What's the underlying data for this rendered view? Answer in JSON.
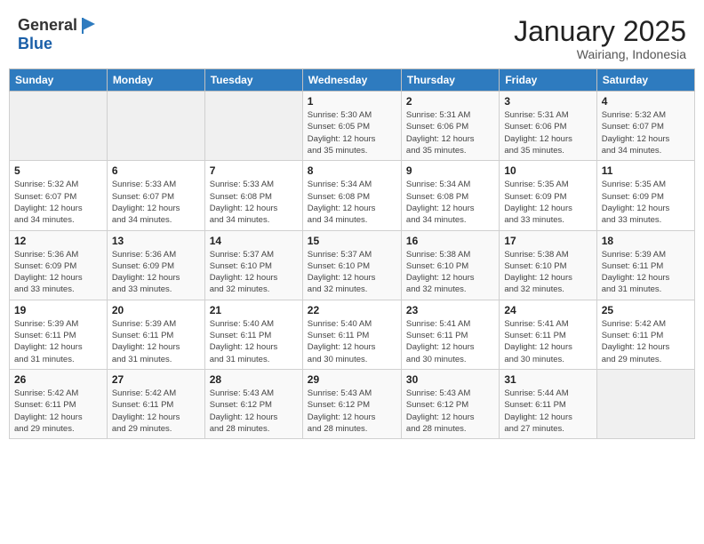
{
  "logo": {
    "general": "General",
    "blue": "Blue"
  },
  "header": {
    "title": "January 2025",
    "subtitle": "Wairiang, Indonesia"
  },
  "weekdays": [
    "Sunday",
    "Monday",
    "Tuesday",
    "Wednesday",
    "Thursday",
    "Friday",
    "Saturday"
  ],
  "weeks": [
    [
      {
        "day": "",
        "info": ""
      },
      {
        "day": "",
        "info": ""
      },
      {
        "day": "",
        "info": ""
      },
      {
        "day": "1",
        "info": "Sunrise: 5:30 AM\nSunset: 6:05 PM\nDaylight: 12 hours\nand 35 minutes."
      },
      {
        "day": "2",
        "info": "Sunrise: 5:31 AM\nSunset: 6:06 PM\nDaylight: 12 hours\nand 35 minutes."
      },
      {
        "day": "3",
        "info": "Sunrise: 5:31 AM\nSunset: 6:06 PM\nDaylight: 12 hours\nand 35 minutes."
      },
      {
        "day": "4",
        "info": "Sunrise: 5:32 AM\nSunset: 6:07 PM\nDaylight: 12 hours\nand 34 minutes."
      }
    ],
    [
      {
        "day": "5",
        "info": "Sunrise: 5:32 AM\nSunset: 6:07 PM\nDaylight: 12 hours\nand 34 minutes."
      },
      {
        "day": "6",
        "info": "Sunrise: 5:33 AM\nSunset: 6:07 PM\nDaylight: 12 hours\nand 34 minutes."
      },
      {
        "day": "7",
        "info": "Sunrise: 5:33 AM\nSunset: 6:08 PM\nDaylight: 12 hours\nand 34 minutes."
      },
      {
        "day": "8",
        "info": "Sunrise: 5:34 AM\nSunset: 6:08 PM\nDaylight: 12 hours\nand 34 minutes."
      },
      {
        "day": "9",
        "info": "Sunrise: 5:34 AM\nSunset: 6:08 PM\nDaylight: 12 hours\nand 34 minutes."
      },
      {
        "day": "10",
        "info": "Sunrise: 5:35 AM\nSunset: 6:09 PM\nDaylight: 12 hours\nand 33 minutes."
      },
      {
        "day": "11",
        "info": "Sunrise: 5:35 AM\nSunset: 6:09 PM\nDaylight: 12 hours\nand 33 minutes."
      }
    ],
    [
      {
        "day": "12",
        "info": "Sunrise: 5:36 AM\nSunset: 6:09 PM\nDaylight: 12 hours\nand 33 minutes."
      },
      {
        "day": "13",
        "info": "Sunrise: 5:36 AM\nSunset: 6:09 PM\nDaylight: 12 hours\nand 33 minutes."
      },
      {
        "day": "14",
        "info": "Sunrise: 5:37 AM\nSunset: 6:10 PM\nDaylight: 12 hours\nand 32 minutes."
      },
      {
        "day": "15",
        "info": "Sunrise: 5:37 AM\nSunset: 6:10 PM\nDaylight: 12 hours\nand 32 minutes."
      },
      {
        "day": "16",
        "info": "Sunrise: 5:38 AM\nSunset: 6:10 PM\nDaylight: 12 hours\nand 32 minutes."
      },
      {
        "day": "17",
        "info": "Sunrise: 5:38 AM\nSunset: 6:10 PM\nDaylight: 12 hours\nand 32 minutes."
      },
      {
        "day": "18",
        "info": "Sunrise: 5:39 AM\nSunset: 6:11 PM\nDaylight: 12 hours\nand 31 minutes."
      }
    ],
    [
      {
        "day": "19",
        "info": "Sunrise: 5:39 AM\nSunset: 6:11 PM\nDaylight: 12 hours\nand 31 minutes."
      },
      {
        "day": "20",
        "info": "Sunrise: 5:39 AM\nSunset: 6:11 PM\nDaylight: 12 hours\nand 31 minutes."
      },
      {
        "day": "21",
        "info": "Sunrise: 5:40 AM\nSunset: 6:11 PM\nDaylight: 12 hours\nand 31 minutes."
      },
      {
        "day": "22",
        "info": "Sunrise: 5:40 AM\nSunset: 6:11 PM\nDaylight: 12 hours\nand 30 minutes."
      },
      {
        "day": "23",
        "info": "Sunrise: 5:41 AM\nSunset: 6:11 PM\nDaylight: 12 hours\nand 30 minutes."
      },
      {
        "day": "24",
        "info": "Sunrise: 5:41 AM\nSunset: 6:11 PM\nDaylight: 12 hours\nand 30 minutes."
      },
      {
        "day": "25",
        "info": "Sunrise: 5:42 AM\nSunset: 6:11 PM\nDaylight: 12 hours\nand 29 minutes."
      }
    ],
    [
      {
        "day": "26",
        "info": "Sunrise: 5:42 AM\nSunset: 6:11 PM\nDaylight: 12 hours\nand 29 minutes."
      },
      {
        "day": "27",
        "info": "Sunrise: 5:42 AM\nSunset: 6:11 PM\nDaylight: 12 hours\nand 29 minutes."
      },
      {
        "day": "28",
        "info": "Sunrise: 5:43 AM\nSunset: 6:12 PM\nDaylight: 12 hours\nand 28 minutes."
      },
      {
        "day": "29",
        "info": "Sunrise: 5:43 AM\nSunset: 6:12 PM\nDaylight: 12 hours\nand 28 minutes."
      },
      {
        "day": "30",
        "info": "Sunrise: 5:43 AM\nSunset: 6:12 PM\nDaylight: 12 hours\nand 28 minutes."
      },
      {
        "day": "31",
        "info": "Sunrise: 5:44 AM\nSunset: 6:11 PM\nDaylight: 12 hours\nand 27 minutes."
      },
      {
        "day": "",
        "info": ""
      }
    ]
  ]
}
